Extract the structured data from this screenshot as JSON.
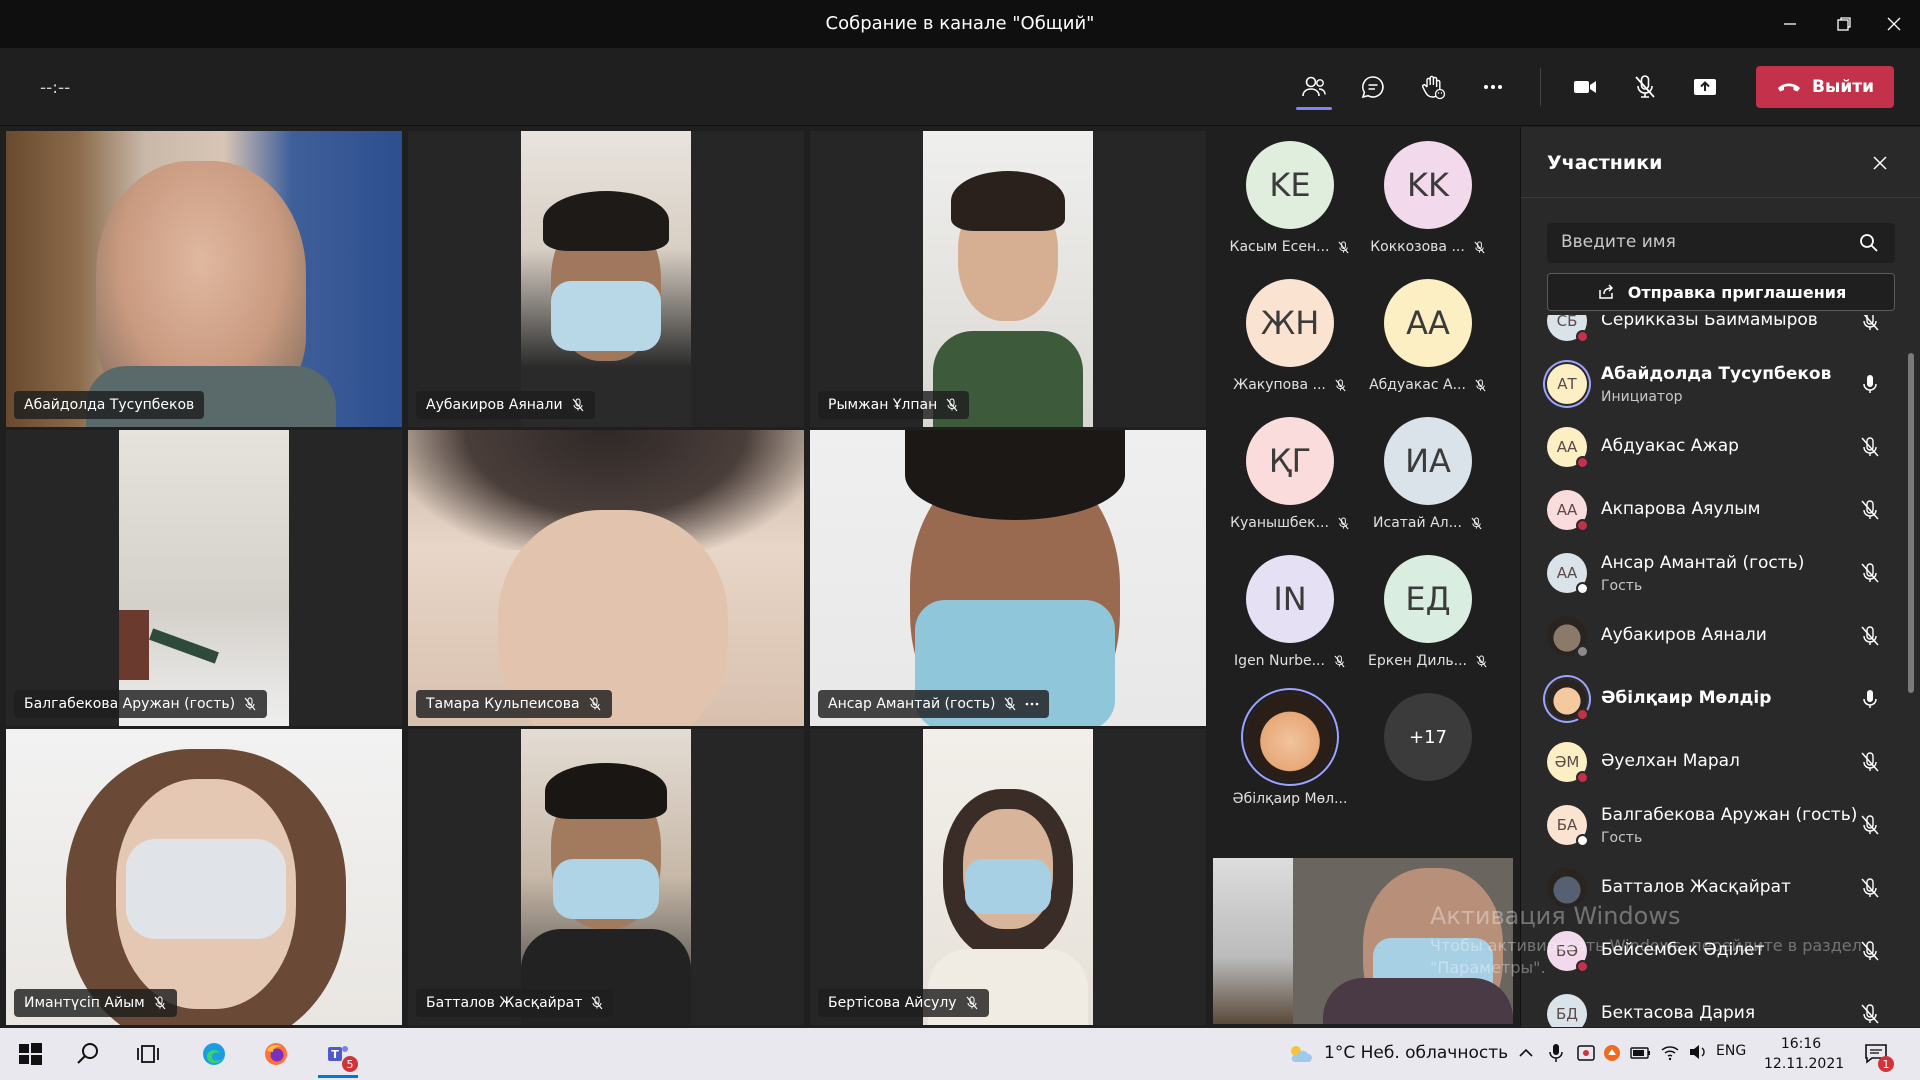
{
  "window": {
    "title": "Собрание в канале \"Общий\""
  },
  "controls": {
    "timer": "--:--",
    "leave_label": "Выйти"
  },
  "tiles": [
    {
      "name": "Абайдолда Тусупбеков"
    },
    {
      "name": "Аубакиров Аянали"
    },
    {
      "name": "Рымжан Ұлпан"
    },
    {
      "name": "Балгабекова Аружан (гость)"
    },
    {
      "name": "Тамара Кульпеисова"
    },
    {
      "name": "Ансар Амантай (гость)"
    },
    {
      "name": "Имантүсіп Айым"
    },
    {
      "name": "Батталов Жасқайрат"
    },
    {
      "name": "Бертісова Айсулу"
    }
  ],
  "roster": [
    {
      "initials": "KE",
      "label": "Касым Есен...",
      "color": "#dfeedd"
    },
    {
      "initials": "KK",
      "label": "Коккозова ...",
      "color": "#f2d9ec"
    },
    {
      "initials": "ЖН",
      "label": "Жакупова ...",
      "color": "#fbe3d1"
    },
    {
      "initials": "АА",
      "label": "Абдуакас А...",
      "color": "#fcefc4"
    },
    {
      "initials": "ҚГ",
      "label": "Куанышбек...",
      "color": "#fbdcdc"
    },
    {
      "initials": "ИА",
      "label": "Исатай Ал...",
      "color": "#dbe3ea"
    },
    {
      "initials": "IN",
      "label": "Igen Nurbe...",
      "color": "#e6e0f5"
    },
    {
      "initials": "ЕД",
      "label": "Еркен Диль...",
      "color": "#d9eee0"
    },
    {
      "initials": "",
      "label": "Әбілқаир Мөл...",
      "color": "#f4c9a0"
    },
    {
      "initials": "+17",
      "label": "",
      "color": "#3b3b3b"
    }
  ],
  "panel": {
    "title": "Участники",
    "search_placeholder": "Введите имя",
    "invite_label": "Отправка приглашения",
    "participants": [
      {
        "initials": "СБ",
        "name": "Серикказы Баймамыров",
        "role": "",
        "color": "#dbe3ea",
        "status": "#c4314b",
        "mic": "muted"
      },
      {
        "initials": "АТ",
        "name": "Абайдолда Тусупбеков",
        "role": "Инициатор",
        "color": "#fcefc4",
        "status": "",
        "mic": "on",
        "bold": true,
        "ring": true
      },
      {
        "initials": "АА",
        "name": "Абдуакас Ажар",
        "role": "",
        "color": "#fcefc4",
        "status": "#c4314b",
        "mic": "muted"
      },
      {
        "initials": "АА",
        "name": "Акпарова Аяулым",
        "role": "",
        "color": "#fbdcdc",
        "status": "#c4314b",
        "mic": "muted"
      },
      {
        "initials": "АА",
        "name": "Ансар Амантай (гость)",
        "role": "Гость",
        "color": "#dbe3ea",
        "status": "#ffffff",
        "mic": "muted"
      },
      {
        "initials": "",
        "name": "Аубакиров Аянали",
        "role": "",
        "color": "#8b7a6a",
        "status": "#8a8a8a",
        "mic": "muted"
      },
      {
        "initials": "",
        "name": "Әбілқаир Мөлдір",
        "role": "",
        "color": "#f4c9a0",
        "status": "#c4314b",
        "mic": "on",
        "bold": true,
        "ring": true
      },
      {
        "initials": "ӘМ",
        "name": "Әуелхан Марал",
        "role": "",
        "color": "#fcefc4",
        "status": "#c4314b",
        "mic": "muted"
      },
      {
        "initials": "БА",
        "name": "Балгабекова Аружан (гость)",
        "role": "Гость",
        "color": "#fbe3d1",
        "status": "#ffffff",
        "mic": "muted"
      },
      {
        "initials": "",
        "name": "Батталов Жасқайрат",
        "role": "",
        "color": "#556070",
        "status": "",
        "mic": "muted"
      },
      {
        "initials": "БӘ",
        "name": "Бейсембек Әділет",
        "role": "",
        "color": "#f2d9ec",
        "status": "#c4314b",
        "mic": "muted"
      },
      {
        "initials": "БД",
        "name": "Бектасова Дария",
        "role": "",
        "color": "#dbe3ea",
        "status": "",
        "mic": "muted"
      }
    ]
  },
  "watermark": {
    "line1": "Активация Windows",
    "line2": "Чтобы активировать Windows, перейдите в раздел",
    "line3": "\"Параметры\"."
  },
  "taskbar": {
    "weather": "1°C  Неб. облачность",
    "lang": "ENG",
    "time": "16:16",
    "date": "12.11.2021",
    "teams_badge": "5",
    "notif_badge": "1"
  }
}
